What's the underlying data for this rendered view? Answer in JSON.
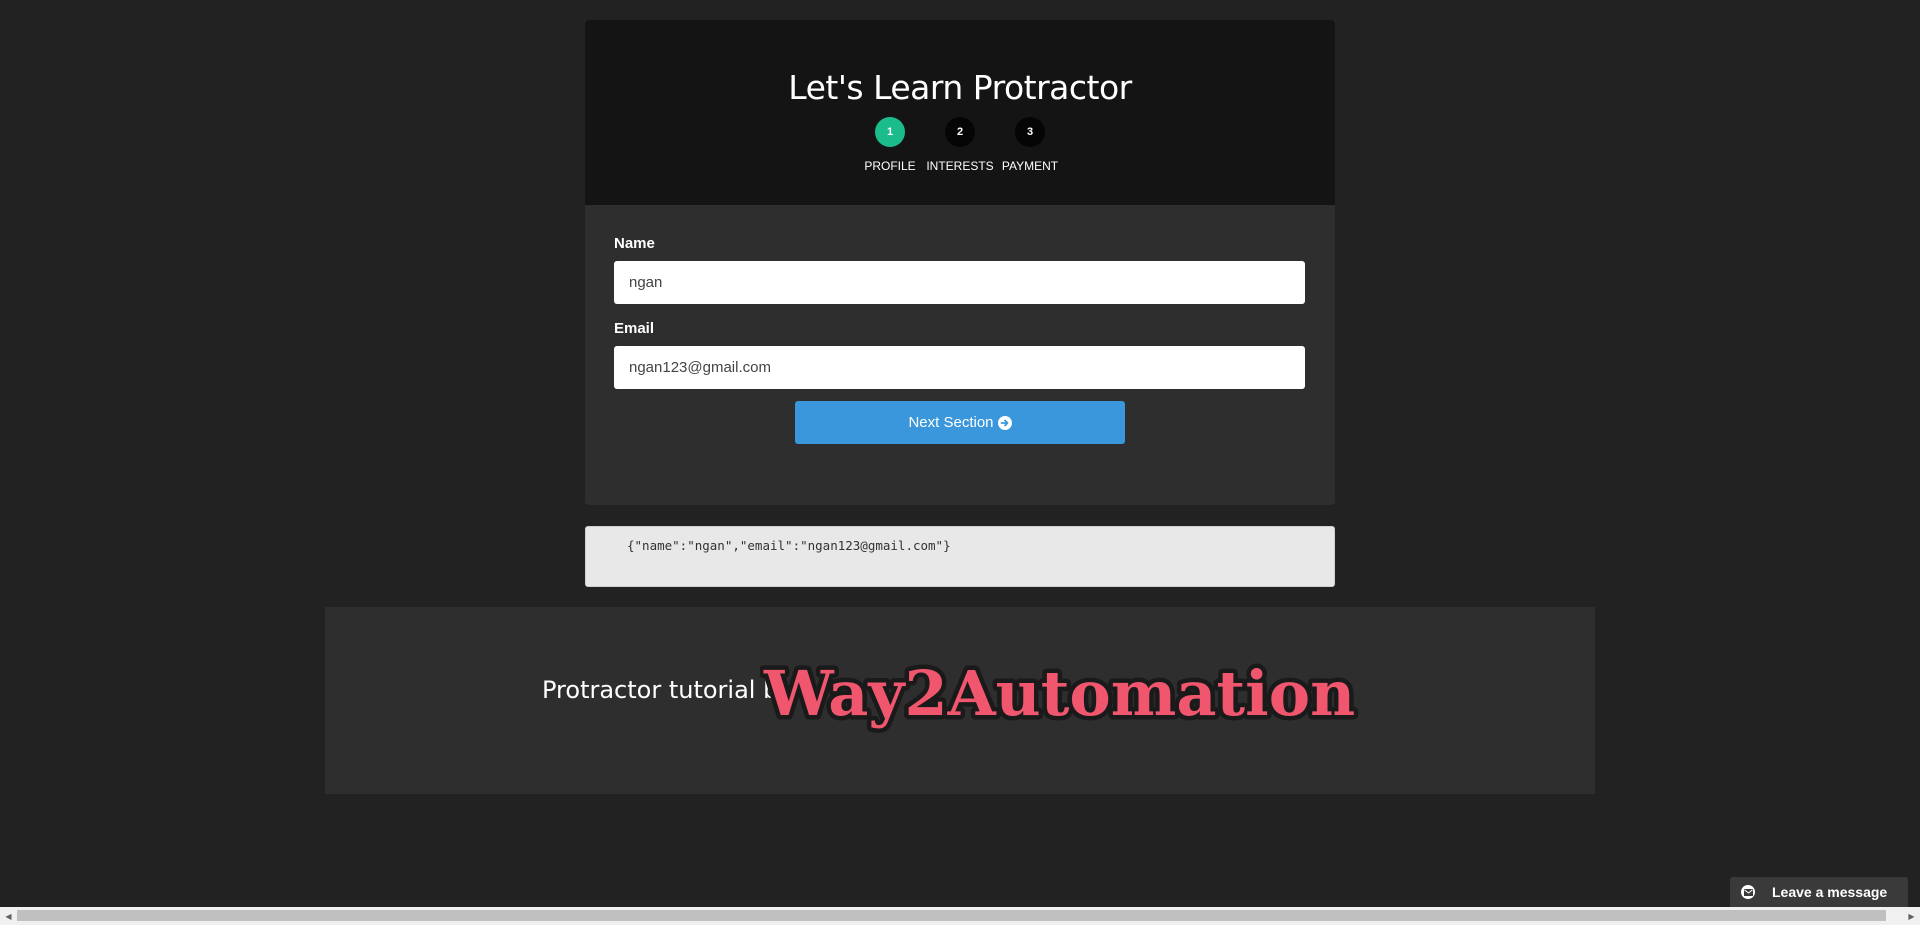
{
  "header": {
    "title": "Let's Learn Protractor",
    "steps": [
      {
        "number": "1",
        "label": "PROFILE",
        "active": true
      },
      {
        "number": "2",
        "label": "INTERESTS",
        "active": false
      },
      {
        "number": "3",
        "label": "PAYMENT",
        "active": false
      }
    ]
  },
  "form": {
    "name_label": "Name",
    "name_value": "ngan",
    "email_label": "Email",
    "email_value": "ngan123@gmail.com",
    "next_label": "Next Section",
    "next_icon": "arrow-circle-right-icon"
  },
  "json_output": "{\"name\":\"ngan\",\"email\":\"ngan123@gmail.com\"}",
  "footer": {
    "text": "Protractor tutorial by",
    "logo_text": "Way2Automation"
  },
  "chat": {
    "label": "Leave a message",
    "icon": "envelope-icon"
  },
  "colors": {
    "page_bg": "#222222",
    "header_bg": "#141414",
    "card_bg": "#2e2e2e",
    "active_step": "#1abc8c",
    "button": "#3a97dc",
    "logo_fill": "#f0566e",
    "logo_outline": "#1a1a1a"
  }
}
